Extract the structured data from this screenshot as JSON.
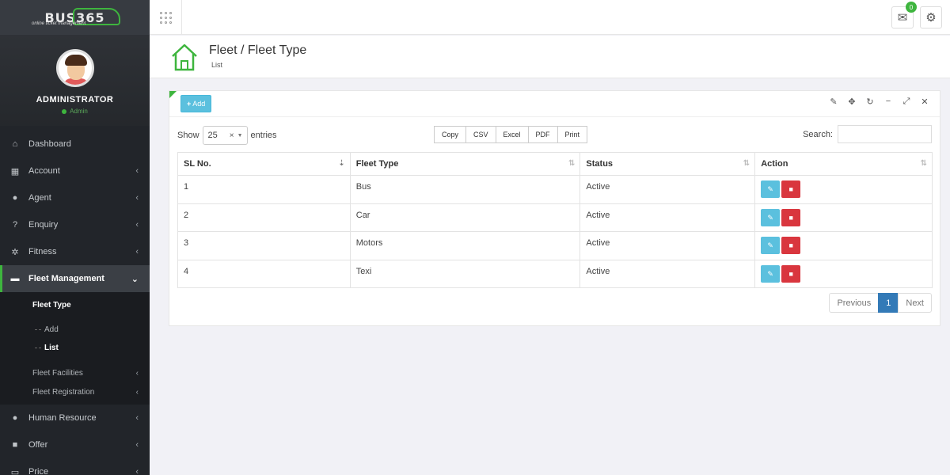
{
  "brand": {
    "name": "BUS365",
    "tagline": "online ticket management"
  },
  "user": {
    "name": "ADMINISTRATOR",
    "role": "Admin"
  },
  "menu": {
    "items": [
      {
        "label": "Dashboard",
        "icon": "home-icon"
      },
      {
        "label": "Account",
        "icon": "calculator-icon"
      },
      {
        "label": "Agent",
        "icon": "user-icon"
      },
      {
        "label": "Enquiry",
        "icon": "question-icon"
      },
      {
        "label": "Fitness",
        "icon": "gear-icon"
      },
      {
        "label": "Fleet Management",
        "icon": "car-icon"
      },
      {
        "label": "Human Resource",
        "icon": "users-icon"
      },
      {
        "label": "Offer",
        "icon": "gift-icon"
      },
      {
        "label": "Price",
        "icon": "money-icon"
      }
    ],
    "fleet_sub": {
      "fleet_type": "Fleet Type",
      "add": "Add",
      "list": "List",
      "fleet_facilities": "Fleet Facilities",
      "fleet_registration": "Fleet Registration"
    }
  },
  "topbar": {
    "notification_count": "0"
  },
  "page": {
    "title": "Fleet / Fleet Type",
    "subtitle": "List"
  },
  "panel": {
    "add_label": "Add",
    "show_label": "Show",
    "entries_value": "25",
    "entries_label": "entries",
    "export_buttons": [
      "Copy",
      "CSV",
      "Excel",
      "PDF",
      "Print"
    ],
    "search_label": "Search:",
    "search_value": ""
  },
  "table": {
    "headers": [
      "SL No.",
      "Fleet Type",
      "Status",
      "Action"
    ],
    "rows": [
      {
        "sl": "1",
        "type": "Bus",
        "status": "Active"
      },
      {
        "sl": "2",
        "type": "Car",
        "status": "Active"
      },
      {
        "sl": "3",
        "type": "Motors",
        "status": "Active"
      },
      {
        "sl": "4",
        "type": "Texi",
        "status": "Active"
      }
    ]
  },
  "pagination": {
    "previous": "Previous",
    "current": "1",
    "next": "Next"
  },
  "colors": {
    "accent": "#3eb53e",
    "info": "#5bc0de",
    "danger": "#d9363e",
    "primary": "#337ab7",
    "sidebar": "#22252a"
  }
}
